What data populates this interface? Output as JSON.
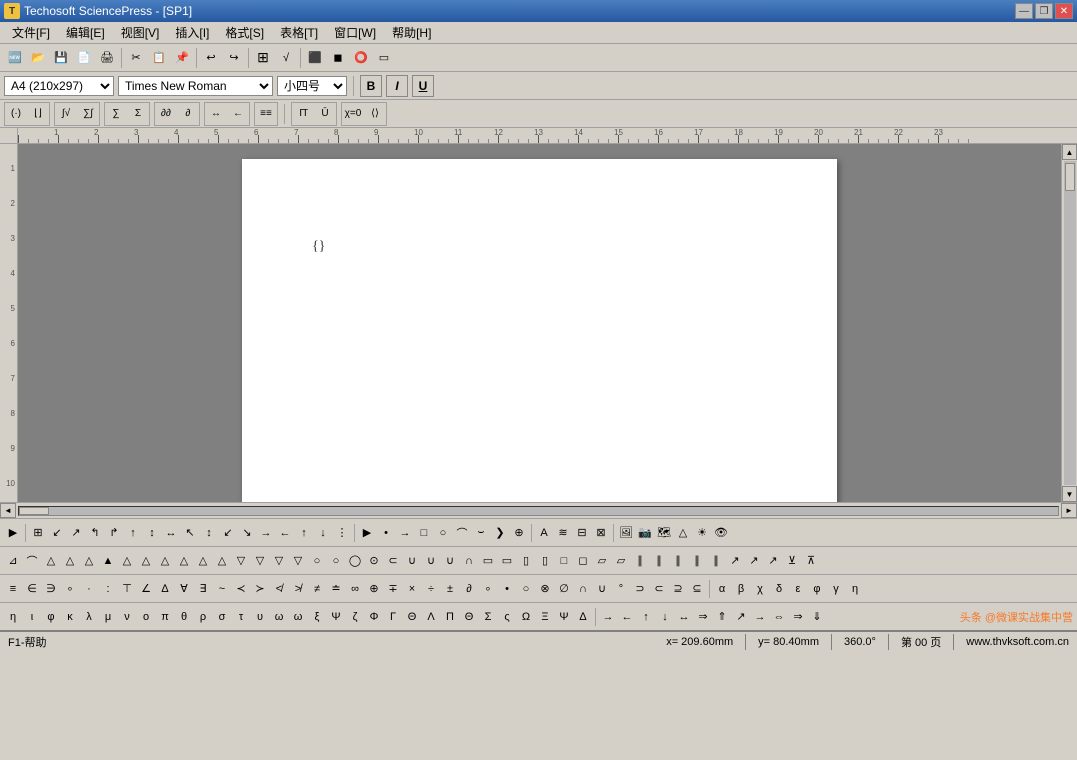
{
  "titlebar": {
    "title": "Techosoft SciencePress - [SP1]",
    "icon_label": "T",
    "min_btn": "—",
    "restore_btn": "❐",
    "close_btn": "✕",
    "outer_min": "—",
    "outer_restore": "❐",
    "outer_close": "✕"
  },
  "menubar": {
    "items": [
      {
        "label": "文件[F]"
      },
      {
        "label": "编辑[E]"
      },
      {
        "label": "视图[V]"
      },
      {
        "label": "插入[I]"
      },
      {
        "label": "格式[S]"
      },
      {
        "label": "表格[T]"
      },
      {
        "label": "窗口[W]"
      },
      {
        "label": "帮助[H]"
      }
    ]
  },
  "toolbar1": {
    "buttons": [
      "🆕",
      "📂",
      "💾",
      "📄",
      "🖨",
      "✂",
      "📋",
      "📌",
      "↩",
      "↪",
      "📊",
      "📈",
      "⬛",
      "◼",
      "⭕",
      "▭"
    ]
  },
  "toolbar2": {
    "page_size": "A4  (210x297)",
    "font_name": "Times New Roman",
    "font_size": "小四号",
    "bold": "B",
    "italic": "I",
    "underline": "U"
  },
  "toolbar3": {
    "groups": [
      {
        "symbols": [
          "(·)",
          "∫√"
        ]
      },
      {
        "symbols": [
          "Σ",
          "Σ∫"
        ]
      },
      {
        "symbols": [
          "∂∂",
          "∂"
        ]
      },
      {
        "symbols": [
          "↔←"
        ]
      },
      {
        "symbols": [
          "≡≡"
        ]
      },
      {
        "symbols": [
          "Π̄",
          "Ū"
        ]
      },
      {
        "symbols": [
          "χ=0",
          "⟨⟩"
        ]
      }
    ]
  },
  "page": {
    "cursor_char": "{}"
  },
  "bottom_toolbar1": {
    "buttons": [
      "▶",
      "⊞",
      "↙",
      "↗",
      "←↑",
      "→↑",
      "↑↑",
      "→→",
      "→←",
      "↓↑",
      "↑←",
      "→↓",
      "↓←",
      "↑→",
      "↓↓",
      "←↓",
      "↑↑",
      "↓←",
      "→↑",
      "←↑",
      "↑",
      "/",
      "|",
      "▶",
      "•",
      "→",
      "□",
      "○",
      "∪",
      "⌒",
      "⌣",
      "❯",
      "⊕",
      "□",
      "○",
      "△",
      "∇",
      "←",
      "→",
      "★",
      "⌂",
      "▨"
    ]
  },
  "bottom_toolbar2": {
    "buttons": [
      "↘",
      "⌒",
      "△",
      "△",
      "△",
      "△",
      "△",
      "△",
      "△",
      "△",
      "△",
      "△",
      "△",
      "△",
      "△",
      "△",
      "◯",
      "◯",
      "◯",
      "◯",
      "◯",
      "∪",
      "∪",
      "∪",
      "∪",
      "◻",
      "◻",
      "◻",
      "◻",
      "◻",
      "◻",
      "◻",
      "◻",
      "∥",
      "∥",
      "∥",
      "∥",
      "∥",
      "∥",
      "∥",
      "∥",
      "↗",
      "↗"
    ]
  },
  "sym_bar1": {
    "symbols": [
      "≡",
      "∈",
      "∋",
      "∋",
      "∘",
      "·",
      "·",
      "⊤",
      "∠",
      "∠",
      "∆",
      "∀",
      "∃",
      "~",
      "≺",
      "≻",
      "≮",
      "≯",
      "≠",
      "≐",
      "∞",
      "⊕",
      "∞",
      "∓",
      "×",
      "÷",
      "∓",
      "∂",
      "∘",
      "•",
      "○",
      "⊗",
      "⊕",
      "∅",
      "∩",
      "∪",
      "°",
      "⊃",
      "⊂",
      "⊇",
      "⊆",
      "⊃",
      "⊂",
      "α",
      "β",
      "χ",
      "δ",
      "ε",
      "φ",
      "γ",
      "η"
    ]
  },
  "sym_bar2": {
    "symbols": [
      "η",
      "ι",
      "φ",
      "κ",
      "λ",
      "μ",
      "ν",
      "ο",
      "π",
      "θ",
      "ρ",
      "σ",
      "τ",
      "υ",
      "ω",
      "ω",
      "ξ",
      "Ψ",
      "ζ",
      "Φ",
      "Γ",
      "Θ",
      "Λ",
      "Π",
      "Θ",
      "Σ",
      "ζ",
      "Ω",
      "Ξ",
      "Ψ",
      "∆",
      "→",
      "←",
      "↑",
      "↓",
      "↔",
      "⇒",
      "⇑",
      "↗",
      "→",
      "⇔",
      "⇒",
      "⇑",
      "⇓"
    ]
  },
  "statusbar": {
    "help": "F1-帮助",
    "x_pos": "x= 209.60mm",
    "y_pos": "y= 80.40mm",
    "angle": "360.0°",
    "page": "第 00 页",
    "website": "www.thvksoft.com.cn"
  }
}
